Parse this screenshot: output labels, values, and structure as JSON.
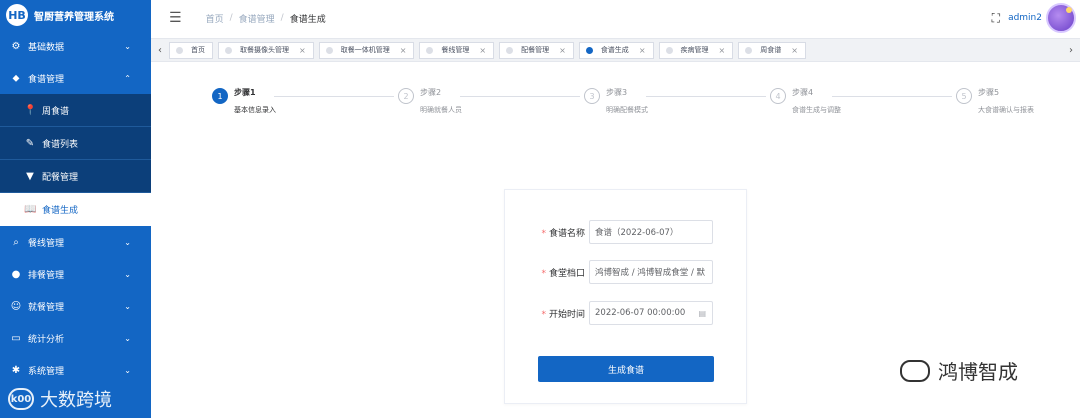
{
  "app": {
    "logo_char": "HB",
    "title": "智厨营养管理系统"
  },
  "sidebar": {
    "items": [
      {
        "label": "基础数据",
        "icon": "settings-icon",
        "glyph": "⚙",
        "chevron": "⌄"
      },
      {
        "label": "食谱管理",
        "icon": "drop-icon",
        "glyph": "⬥",
        "chevron": "⌃"
      }
    ],
    "sub_items": [
      {
        "label": "周食谱",
        "icon": "location-pin-icon",
        "glyph": "📍"
      },
      {
        "label": "食谱列表",
        "icon": "pen-icon",
        "glyph": "✎"
      },
      {
        "label": "配餐管理",
        "icon": "funnel-icon",
        "glyph": "▼"
      },
      {
        "label": "食谱生成",
        "icon": "book-icon",
        "glyph": "📖"
      }
    ],
    "items_after": [
      {
        "label": "餐线管理",
        "icon": "search-icon",
        "glyph": "⌕",
        "chevron": "⌄"
      },
      {
        "label": "排餐管理",
        "icon": "circle-icon",
        "glyph": "●",
        "chevron": "⌄"
      },
      {
        "label": "就餐管理",
        "icon": "smile-icon",
        "glyph": "☺",
        "chevron": "⌄"
      },
      {
        "label": "统计分析",
        "icon": "card-icon",
        "glyph": "▭",
        "chevron": "⌄"
      },
      {
        "label": "系统管理",
        "icon": "gear-icon",
        "glyph": "✱",
        "chevron": "⌄"
      }
    ]
  },
  "watermark_left": {
    "logo": "k00",
    "text": "大数跨境"
  },
  "header": {
    "breadcrumb": [
      "首页",
      "食谱管理",
      "食谱生成"
    ],
    "username": "admin2"
  },
  "tabs": [
    {
      "label": "首页",
      "closable": false,
      "active": false
    },
    {
      "label": "取餐摄像头管理",
      "closable": true,
      "active": false
    },
    {
      "label": "取餐一体机管理",
      "closable": true,
      "active": false
    },
    {
      "label": "餐线管理",
      "closable": true,
      "active": false
    },
    {
      "label": "配餐管理",
      "closable": true,
      "active": false
    },
    {
      "label": "食谱生成",
      "closable": true,
      "active": true
    },
    {
      "label": "疾病管理",
      "closable": true,
      "active": false
    },
    {
      "label": "周食谱",
      "closable": true,
      "active": false
    }
  ],
  "steps": [
    {
      "num": "1",
      "title": "步骤1",
      "desc": "基本信息录入",
      "active": true
    },
    {
      "num": "2",
      "title": "步骤2",
      "desc": "明确就餐人员",
      "active": false
    },
    {
      "num": "3",
      "title": "步骤3",
      "desc": "明确配餐模式",
      "active": false
    },
    {
      "num": "4",
      "title": "步骤4",
      "desc": "食谱生成与调整",
      "active": false
    },
    {
      "num": "5",
      "title": "步骤5",
      "desc": "大食谱确认与报表",
      "active": false
    }
  ],
  "form": {
    "required_mark": "*",
    "recipe_name": {
      "label": "食谱名称",
      "value": "食谱（2022-06-07）"
    },
    "canteen": {
      "label": "食堂档口",
      "value": "鸿博智成 / 鸿博智成食堂 / 默"
    },
    "start_time": {
      "label": "开始时间",
      "value": "2022-06-07 00:00:00"
    },
    "submit_label": "生成食谱"
  },
  "watermark_right": {
    "text": "鸿博智成"
  }
}
